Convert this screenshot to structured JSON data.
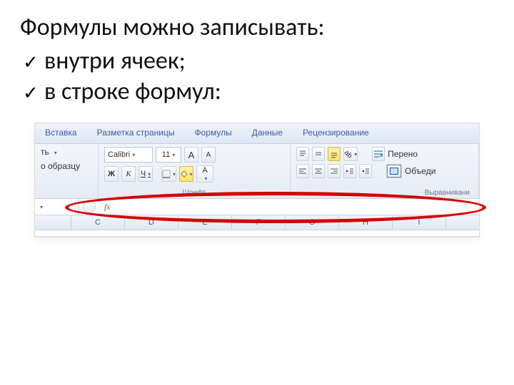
{
  "heading": "Формулы можно записывать:",
  "bullets": {
    "b1": "внутри ячеек;",
    "b2": "в строке формул:"
  },
  "ribbon": {
    "tabs": {
      "t1": "Вставка",
      "t2": "Разметка страницы",
      "t3": "Формулы",
      "t4": "Данные",
      "t5": "Рецензирование"
    },
    "clipboard": {
      "paste_suffix": "ть",
      "format_painter": "о образцу"
    },
    "font": {
      "name": "Calibri",
      "size": "11",
      "grow": "А",
      "shrink": "А",
      "bold": "Ж",
      "italic": "К",
      "underline": "Ч",
      "color_letter": "А",
      "group_label": "Шрифт"
    },
    "align": {
      "wrap_text": "Перено",
      "merge": "Объеди",
      "group_label": "Выравнивани"
    }
  },
  "formula_bar": {
    "fx": "fx"
  },
  "columns": {
    "c1": "C",
    "c2": "D",
    "c3": "E",
    "c4": "F",
    "c5": "G",
    "c6": "H",
    "c7": "I"
  }
}
